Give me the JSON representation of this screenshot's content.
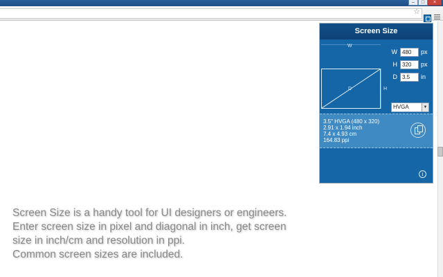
{
  "popup": {
    "title": "Screen Size",
    "diagram": {
      "w_label": "W",
      "h_label": "H",
      "d_label": "D"
    },
    "fields": [
      {
        "label": "W",
        "value": "480",
        "unit": "px"
      },
      {
        "label": "H",
        "value": "320",
        "unit": "px"
      },
      {
        "label": "D",
        "value": "3.5",
        "unit": "in"
      }
    ],
    "preset": "HVGA",
    "results": [
      "3.5\" HVGA (480 x 320)",
      "2.91 x 1.94 inch",
      "7.4 x 4.93 cm",
      "164.83 ppi"
    ],
    "copy_icon": "copy-icon",
    "info_icon": "i"
  },
  "description": [
    "Screen Size is a handy tool for UI designers or engineers.",
    "Enter screen size in pixel and diagonal in inch, get screen",
    "size in inch/cm and resolution in ppi.",
    "Common screen sizes are included."
  ],
  "toolbar": {
    "star": "☆"
  },
  "colors": {
    "popup_bg": "#1466a6",
    "header_bg": "#0d4276",
    "result_bg": "#3f8ac2",
    "text_gray": "#8a8a8a"
  }
}
